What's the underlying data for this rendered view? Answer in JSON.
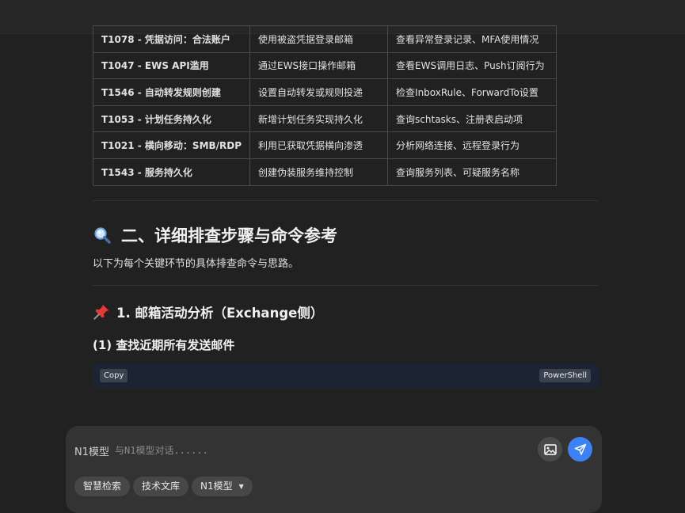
{
  "threat_table": {
    "rows": [
      {
        "technique": "T1078 - 凭据访问：合法账户",
        "description": "使用被盗凭据登录邮箱",
        "detection": "查看异常登录记录、MFA使用情况"
      },
      {
        "technique": "T1047 - EWS API滥用",
        "description": "通过EWS接口操作邮箱",
        "detection": "查看EWS调用日志、Push订阅行为"
      },
      {
        "technique": "T1546 - 自动转发规则创建",
        "description": "设置自动转发或规则投递",
        "detection": "检查InboxRule、ForwardTo设置"
      },
      {
        "technique": "T1053 - 计划任务持久化",
        "description": "新增计划任务实现持久化",
        "detection": "查询schtasks、注册表启动项"
      },
      {
        "technique": "T1021 - 横向移动：SMB/RDP",
        "description": "利用已获取凭据横向渗透",
        "detection": "分析网络连接、远程登录行为"
      },
      {
        "technique": "T1543 - 服务持久化",
        "description": "创建伪装服务维持控制",
        "detection": "查询服务列表、可疑服务名称"
      }
    ]
  },
  "section2": {
    "icon": "magnifier-icon",
    "title": "二、详细排查步骤与命令参考",
    "intro": "以下为每个关键环节的具体排查命令与思路。"
  },
  "subsection1": {
    "icon": "pushpin-icon",
    "title": "1. 邮箱活动分析（Exchange侧）",
    "step_title": "(1) 查找近期所有发送邮件"
  },
  "codeblock": {
    "copy_label": "Copy",
    "language": "PowerShell"
  },
  "chat": {
    "model_label": "N1模型",
    "placeholder": "与N1模型对话......",
    "value": "",
    "chips": {
      "smart_search": "智慧检索",
      "tech_library": "技术文库",
      "model_select": "N1模型"
    },
    "colors": {
      "send_button": "#3b82f6"
    }
  }
}
